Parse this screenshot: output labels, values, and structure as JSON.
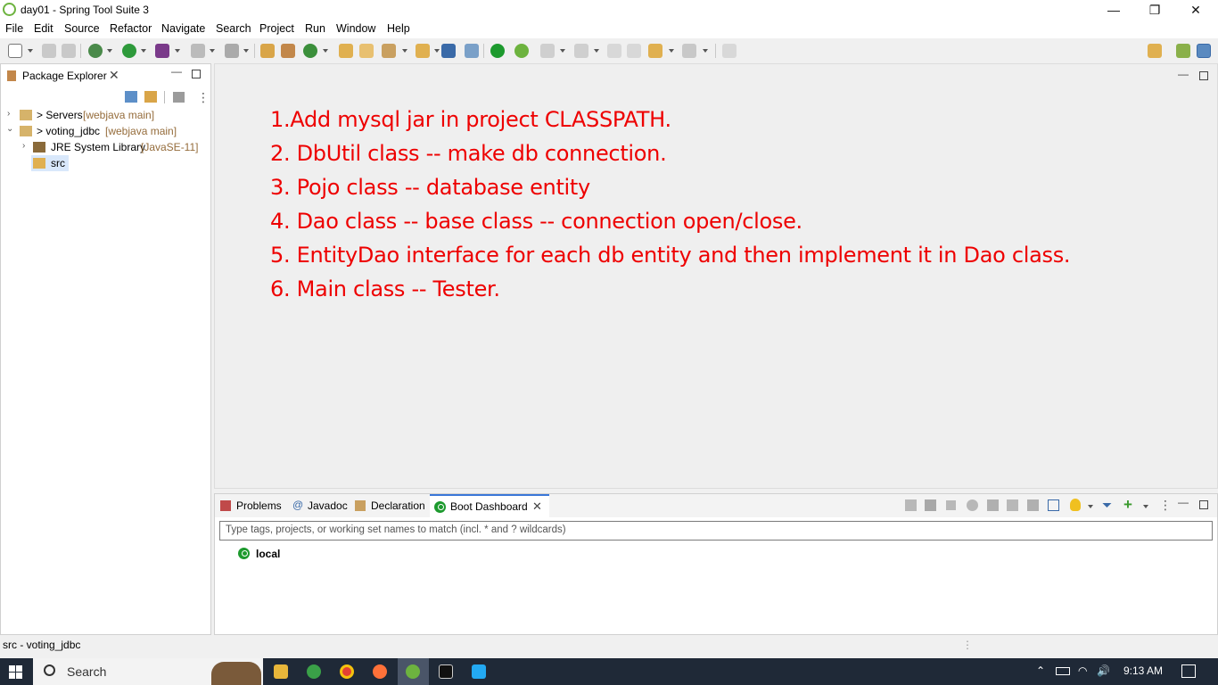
{
  "window": {
    "title": "day01 - Spring Tool Suite 3",
    "min": "—",
    "max": "❐",
    "close": "✕"
  },
  "menu": [
    "File",
    "Edit",
    "Source",
    "Refactor",
    "Navigate",
    "Search",
    "Project",
    "Run",
    "Window",
    "Help"
  ],
  "package_explorer": {
    "tab_label": "Package Explorer",
    "tree": [
      {
        "name": "> Servers",
        "decoration": "[webjava main]"
      },
      {
        "name": "> voting_jdbc",
        "decoration": "[webjava main]"
      },
      {
        "name": "JRE System Library",
        "decoration": "[JavaSE-11]"
      },
      {
        "name": "src",
        "decoration": ""
      }
    ]
  },
  "editor": {
    "notes": [
      "1.Add mysql jar in project CLASSPATH.",
      "2. DbUtil class -- make db connection.",
      "3. Pojo class -- database entity",
      "4. Dao class -- base class -- connection open/close.",
      "5. EntityDao interface for each db entity and then implement it in Dao class.",
      "6. Main class -- Tester."
    ]
  },
  "bottom_panel": {
    "tabs": [
      "Problems",
      "Javadoc",
      "Declaration",
      "Boot Dashboard"
    ],
    "active_tab": "Boot Dashboard",
    "filter_placeholder": "Type tags, projects, or working set names to match (incl. * and ? wildcards)",
    "items": [
      {
        "name": "local"
      }
    ]
  },
  "status": {
    "text": "src - voting_jdbc"
  },
  "taskbar": {
    "search_label": "Search",
    "time": "9:13 AM"
  },
  "colors": {
    "note_red": "#ee0000",
    "spring_green": "#6db33f",
    "boot_green": "#1d9a2e"
  }
}
